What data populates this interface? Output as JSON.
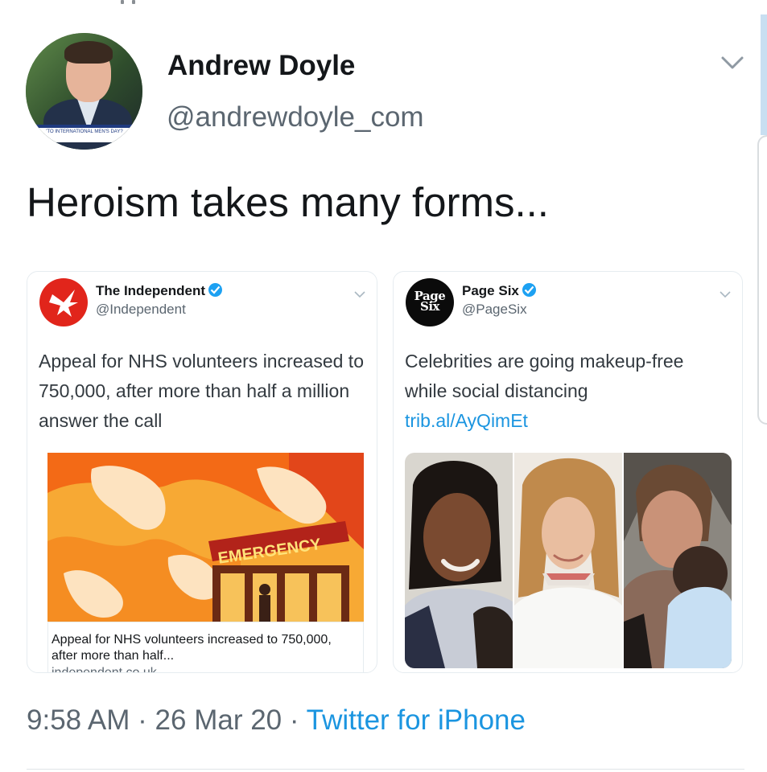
{
  "tweet": {
    "author_name": "Andrew Doyle",
    "author_handle": "@andrewdoyle_com",
    "avatar_banner": "'TO INTERNATIONAL MEN'S DAY?",
    "text": "Heroism takes many forms...",
    "time": "9:58 AM",
    "date": "26 Mar 20",
    "separator": "·",
    "source": "Twitter for iPhone"
  },
  "quoted": [
    {
      "name": "The Independent",
      "handle": "@Independent",
      "verified": true,
      "text": "Appeal for NHS volunteers increased to 750,000, after more than half a million answer the call",
      "image_sign": "EMERGENCY",
      "card_title": "Appeal for NHS volunteers increased to 750,000, after more than half...",
      "card_domain": "independent.co.uk",
      "logo_color": "#e1251b"
    },
    {
      "name": "Page Six",
      "handle": "@PageSix",
      "verified": true,
      "text": "Celebrities are going makeup-free while social distancing ",
      "link": "trib.al/AyQimEt",
      "logo_text": "Page Six"
    }
  ],
  "colors": {
    "link": "#1b95e0",
    "verified": "#1da1f2",
    "secondary_text": "#5b6670"
  }
}
